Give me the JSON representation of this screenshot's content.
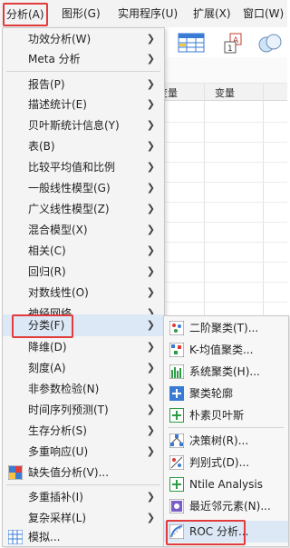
{
  "colors": {
    "highlight": "#e23b3b",
    "selected_bg": "#dde8f6",
    "menu_bg": "#f4f4f4"
  },
  "menubar": [
    {
      "label": "分析(A)",
      "active": true
    },
    {
      "label": "图形(G)"
    },
    {
      "label": "实用程序(U)"
    },
    {
      "label": "扩展(X)"
    },
    {
      "label": "窗口(W)"
    }
  ],
  "grid": {
    "col1": "变量",
    "col2": "变量"
  },
  "analyze_menu": [
    {
      "label": "功效分析(W)",
      "arrow": true
    },
    {
      "label": "Meta 分析",
      "arrow": true
    },
    {
      "label": "报告(P)",
      "arrow": true
    },
    {
      "label": "描述统计(E)",
      "arrow": true
    },
    {
      "label": "贝叶斯统计信息(Y)",
      "arrow": true
    },
    {
      "label": "表(B)",
      "arrow": true
    },
    {
      "label": "比较平均值和比例",
      "arrow": true
    },
    {
      "label": "一般线性模型(G)",
      "arrow": true
    },
    {
      "label": "广义线性模型(Z)",
      "arrow": true
    },
    {
      "label": "混合模型(X)",
      "arrow": true
    },
    {
      "label": "相关(C)",
      "arrow": true
    },
    {
      "label": "回归(R)",
      "arrow": true
    },
    {
      "label": "对数线性(O)",
      "arrow": true
    },
    {
      "label": "神经网络",
      "arrow": true
    },
    {
      "label": "分类(F)",
      "arrow": true,
      "selected": true
    },
    {
      "label": "降维(D)",
      "arrow": true
    },
    {
      "label": "刻度(A)",
      "arrow": true
    },
    {
      "label": "非参数检验(N)",
      "arrow": true
    },
    {
      "label": "时间序列预测(T)",
      "arrow": true
    },
    {
      "label": "生存分析(S)",
      "arrow": true
    },
    {
      "label": "多重响应(U)",
      "arrow": true
    },
    {
      "label": "缺失值分析(V)...",
      "icon": "missing-value-icon"
    },
    {
      "label": "多重插补(I)",
      "arrow": true
    },
    {
      "label": "复杂采样(L)",
      "arrow": true
    },
    {
      "label": "模拟...",
      "icon": "simulation-icon"
    }
  ],
  "classify_submenu": [
    {
      "label": "二阶聚类(T)...",
      "icon": "twostep-cluster-icon"
    },
    {
      "label": "K-均值聚类...",
      "icon": "kmeans-cluster-icon"
    },
    {
      "label": "系统聚类(H)...",
      "icon": "hierarchical-cluster-icon"
    },
    {
      "label": "聚类轮廓",
      "icon": "cluster-silhouette-icon"
    },
    {
      "label": "朴素贝叶斯",
      "icon": "naive-bayes-icon"
    },
    {
      "label": "决策树(R)...",
      "icon": "decision-tree-icon"
    },
    {
      "label": "判别式(D)...",
      "icon": "discriminant-icon"
    },
    {
      "label": "Ntile Analysis",
      "icon": "ntile-icon"
    },
    {
      "label": "最近邻元素(N)...",
      "icon": "nearest-neighbor-icon"
    },
    {
      "label": "ROC 分析...",
      "icon": "roc-icon",
      "selected": true
    }
  ]
}
